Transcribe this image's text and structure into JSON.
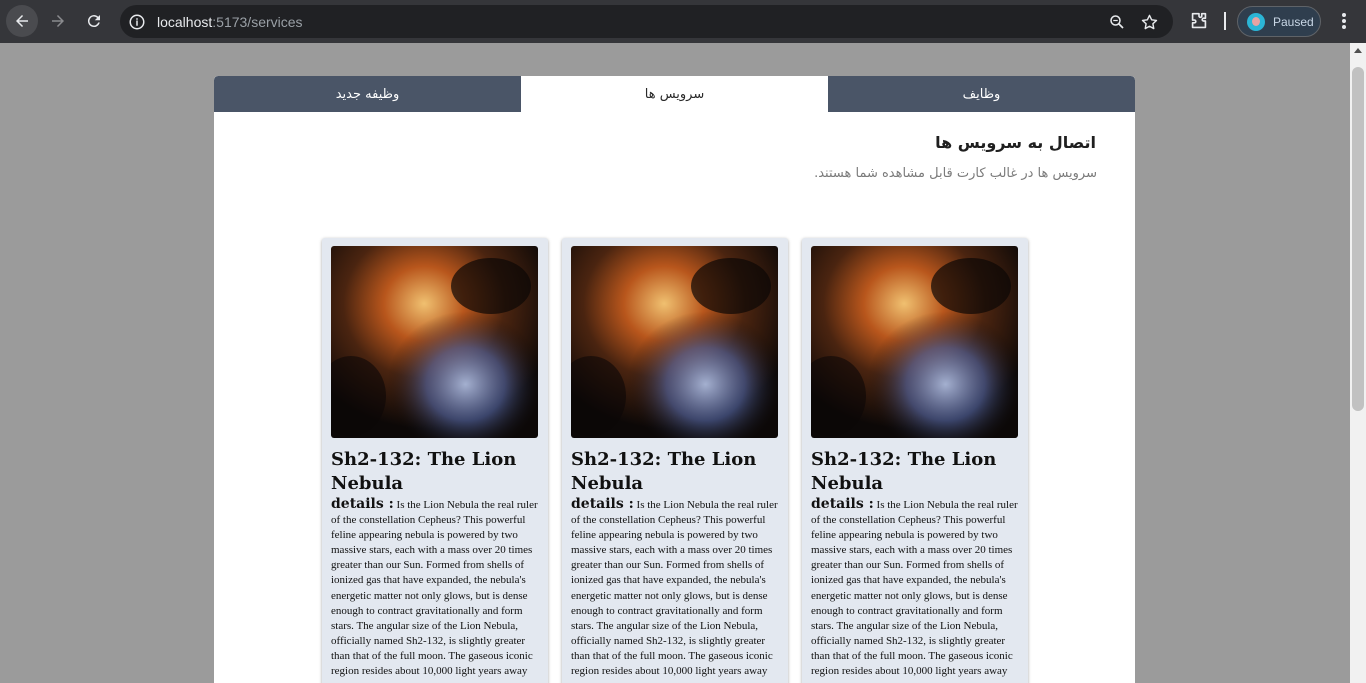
{
  "browser": {
    "url_host": "localhost",
    "url_path": ":5173/services",
    "profile_label": "Paused",
    "icons": [
      "back-arrow-icon",
      "forward-arrow-icon",
      "reload-icon",
      "site-info-icon",
      "zoom-icon",
      "bookmark-star-icon",
      "extensions-icon",
      "kebab-menu-icon"
    ]
  },
  "tabs": [
    {
      "label": "وظیفه جدید",
      "active": false
    },
    {
      "label": "سرویس ها",
      "active": true
    },
    {
      "label": "وظایف",
      "active": false
    }
  ],
  "page": {
    "heading": "اتصال به سرویس ها",
    "subheading": "سرویس ها در غالب کارت قابل مشاهده شما هستند."
  },
  "cards": [
    {
      "title": "Sh2-132: The Lion Nebula",
      "details_label": "details :",
      "details_text": "Is the Lion Nebula the real ruler of the constellation Cepheus? This powerful feline appearing nebula is powered by two massive stars, each with a mass over 20 times greater than our Sun. Formed from shells of ionized gas that have expanded, the nebula's energetic matter not only glows, but is dense enough to contract gravitationally and form stars. The angular size of the Lion Nebula, officially named Sh2-132, is slightly greater than that of the full moon. The gaseous iconic region resides about 10,000 light years away"
    },
    {
      "title": "Sh2-132: The Lion Nebula",
      "details_label": "details :",
      "details_text": "Is the Lion Nebula the real ruler of the constellation Cepheus? This powerful feline appearing nebula is powered by two massive stars, each with a mass over 20 times greater than our Sun. Formed from shells of ionized gas that have expanded, the nebula's energetic matter not only glows, but is dense enough to contract gravitationally and form stars. The angular size of the Lion Nebula, officially named Sh2-132, is slightly greater than that of the full moon. The gaseous iconic region resides about 10,000 light years away"
    },
    {
      "title": "Sh2-132: The Lion Nebula",
      "details_label": "details :",
      "details_text": "Is the Lion Nebula the real ruler of the constellation Cepheus? This powerful feline appearing nebula is powered by two massive stars, each with a mass over 20 times greater than our Sun. Formed from shells of ionized gas that have expanded, the nebula's energetic matter not only glows, but is dense enough to contract gravitationally and form stars. The angular size of the Lion Nebula, officially named Sh2-132, is slightly greater than that of the full moon. The gaseous iconic region resides about 10,000 light years away"
    }
  ],
  "colors": {
    "tab_bg": "#4a5567",
    "card_bg": "#e3e8f0",
    "browser_bar": "#35363a"
  }
}
